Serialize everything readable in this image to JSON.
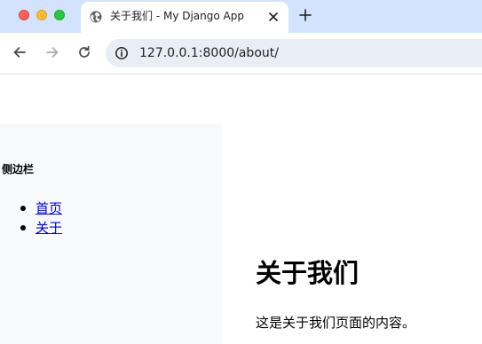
{
  "browser": {
    "tab": {
      "title": "关于我们 - My Django App",
      "favicon_icon": "globe-icon",
      "close_icon": "close-icon"
    },
    "new_tab_icon": "plus-icon",
    "toolbar": {
      "back_icon": "arrow-left-icon",
      "forward_icon": "arrow-right-icon",
      "reload_icon": "reload-icon",
      "site_info_icon": "info-icon",
      "url": "127.0.0.1:8000/about/"
    },
    "colors": {
      "tabstrip": "#d3e3fd",
      "omnibox": "#e9eef6",
      "traffic_close": "#ff5f57",
      "traffic_minimize": "#febc2e",
      "traffic_maximize": "#28c840"
    }
  },
  "page": {
    "sidebar": {
      "title": "侧边栏",
      "items": [
        {
          "label": "首页"
        },
        {
          "label": "关于"
        }
      ]
    },
    "main": {
      "heading": "关于我们",
      "text": "这是关于我们页面的内容。"
    },
    "colors": {
      "sidebar_background": "#f8f9fb",
      "link": "#0000ee"
    }
  }
}
